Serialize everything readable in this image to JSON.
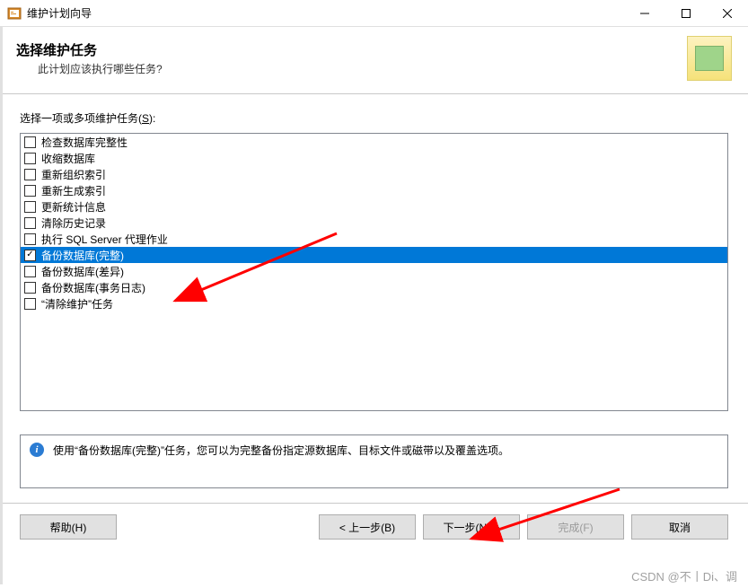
{
  "window": {
    "title": "维护计划向导"
  },
  "header": {
    "title": "选择维护任务",
    "subtitle": "此计划应该执行哪些任务?"
  },
  "prompt": {
    "text_pre": "选择一项或多项维护任务(",
    "accel": "S",
    "text_post": "):"
  },
  "tasks": [
    {
      "label": "检查数据库完整性",
      "checked": false,
      "selected": false
    },
    {
      "label": "收缩数据库",
      "checked": false,
      "selected": false
    },
    {
      "label": "重新组织索引",
      "checked": false,
      "selected": false
    },
    {
      "label": "重新生成索引",
      "checked": false,
      "selected": false
    },
    {
      "label": "更新统计信息",
      "checked": false,
      "selected": false
    },
    {
      "label": "清除历史记录",
      "checked": false,
      "selected": false
    },
    {
      "label": "执行 SQL Server 代理作业",
      "checked": false,
      "selected": false
    },
    {
      "label": "备份数据库(完整)",
      "checked": true,
      "selected": true
    },
    {
      "label": "备份数据库(差异)",
      "checked": false,
      "selected": false
    },
    {
      "label": "备份数据库(事务日志)",
      "checked": false,
      "selected": false
    },
    {
      "label": "“清除维护”任务",
      "checked": false,
      "selected": false
    }
  ],
  "description": {
    "text": "使用“备份数据库(完整)”任务，您可以为完整备份指定源数据库、目标文件或磁带以及覆盖选项。"
  },
  "buttons": {
    "help": "帮助(H)",
    "back": "< 上一步(B)",
    "next": "下一步(N) >",
    "finish": "完成(F)",
    "cancel": "取消"
  },
  "watermark": "CSDN @不丨Di、调"
}
